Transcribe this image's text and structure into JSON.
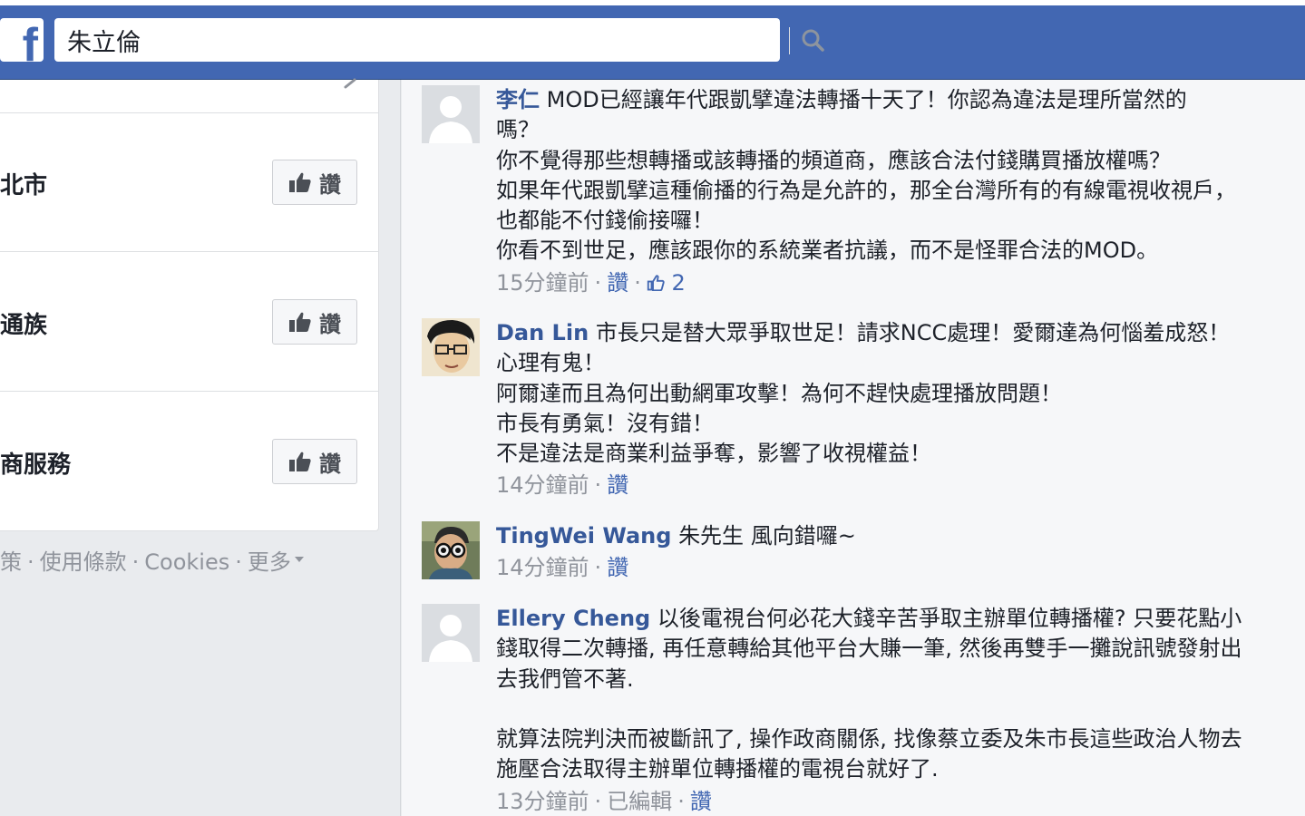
{
  "header": {
    "logo_letter": "f",
    "search_value": "朱立倫"
  },
  "sidebar": {
    "pages": [
      {
        "name": "北市",
        "like_label": "讚"
      },
      {
        "name": "通族",
        "like_label": "讚"
      },
      {
        "name": "商服務",
        "like_label": "讚"
      }
    ],
    "footer": {
      "links": [
        "策",
        "使用條款",
        "Cookies",
        "更多"
      ]
    }
  },
  "comments": [
    {
      "author": "李仁",
      "lines": [
        "MOD已經讓年代跟凱擘違法轉播十天了！你認為違法是理所當然的",
        "嗎？",
        "你不覺得那些想轉播或該轉播的頻道商，應該合法付錢購買播放權嗎？",
        "如果年代跟凱擘這種偷播的行為是允許的，那全台灣所有的有線電視收視戶，",
        "也都能不付錢偷接囉！",
        "你看不到世足，應該跟你的系統業者抗議，而不是怪罪合法的MOD。"
      ],
      "time": "15分鐘前",
      "like_label": "讚",
      "like_count": "2"
    },
    {
      "author": "Dan Lin",
      "lines": [
        "市長只是替大眾爭取世足！請求NCC處理！愛爾達為何惱羞成怒！",
        "心理有鬼！",
        "阿爾達而且為何出動網軍攻擊！為何不趕快處理播放問題！",
        "市長有勇氣！沒有錯！",
        "不是違法是商業利益爭奪，影響了收視權益！"
      ],
      "time": "14分鐘前",
      "like_label": "讚"
    },
    {
      "author": "TingWei Wang",
      "lines": [
        "朱先生 風向錯囉~"
      ],
      "time": "14分鐘前",
      "like_label": "讚"
    },
    {
      "author": "Ellery Cheng",
      "lines": [
        "以後電視台何必花大錢辛苦爭取主辦單位轉播權? 只要花點小",
        "錢取得二次轉播, 再任意轉給其他平台大賺一筆, 然後再雙手一攤說訊號發射出",
        "去我們管不著.",
        "",
        "就算法院判決而被斷訊了, 操作政商關係, 找像蔡立委及朱市長這些政治人物去",
        "施壓合法取得主辦單位轉播權的電視台就好了."
      ],
      "time": "13分鐘前",
      "edited": "已編輯",
      "like_label": "讚"
    }
  ],
  "colors": {
    "brand": "#4267b2",
    "link": "#365899",
    "meta": "#90949c"
  }
}
